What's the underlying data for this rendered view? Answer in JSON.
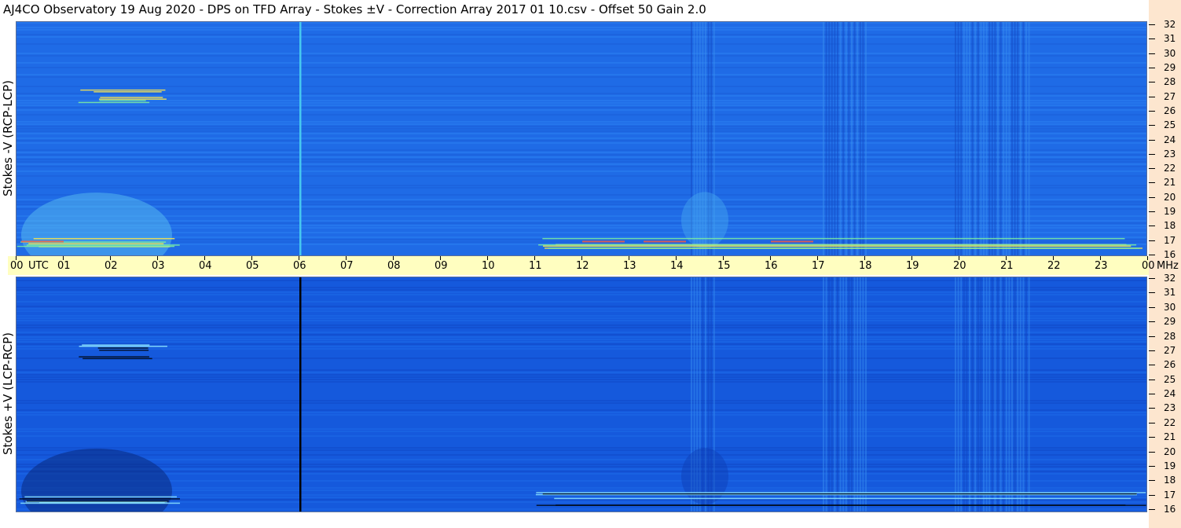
{
  "title": "AJ4CO Observatory  19 Aug 2020  -  DPS on TFD Array  -  Stokes ±V  -  Correction Array 2017 01 10.csv  -  Offset 50  Gain 2.0",
  "chart_data": [
    {
      "type": "heatmap",
      "ylabel": "Stokes -V (RCP-LCP)",
      "x_unit": "UTC",
      "y_unit": "MHz",
      "xlim": [
        0,
        24
      ],
      "ylim": [
        16,
        32
      ],
      "colormap": [
        "#0a2a9a",
        "#1f6be6",
        "#2f8df5",
        "#6ad0f5",
        "#ffe84a",
        "#ff5a3a"
      ],
      "features": [
        {
          "kind": "marker_line",
          "time_utc": 6.0,
          "color": "#46c8f0"
        },
        {
          "kind": "burst_band",
          "time_utc": [
            11.0,
            24.0
          ],
          "freq_mhz": 17.0
        },
        {
          "kind": "burst_band",
          "time_utc": [
            0.0,
            3.5
          ],
          "freq_mhz": 17.0
        },
        {
          "kind": "burst_band",
          "time_utc": [
            1.3,
            3.2
          ],
          "freq_mhz": 27.0
        }
      ]
    },
    {
      "type": "heatmap",
      "ylabel": "Stokes +V (LCP-RCP)",
      "x_unit": "UTC",
      "y_unit": "MHz",
      "xlim": [
        0,
        24
      ],
      "ylim": [
        16,
        32
      ],
      "colormap": [
        "#000814",
        "#0a2a9a",
        "#1f6be6",
        "#2f8df5",
        "#6ad0f5"
      ],
      "features": [
        {
          "kind": "marker_line",
          "time_utc": 6.0,
          "color": "#000000"
        },
        {
          "kind": "burst_band",
          "time_utc": [
            11.0,
            24.0
          ],
          "freq_mhz": 17.0
        },
        {
          "kind": "burst_band",
          "time_utc": [
            0.0,
            3.5
          ],
          "freq_mhz": 17.0
        },
        {
          "kind": "burst_band",
          "time_utc": [
            1.3,
            3.2
          ],
          "freq_mhz": 27.0
        }
      ]
    }
  ],
  "time_axis": {
    "labels": [
      "00",
      "01",
      "02",
      "03",
      "04",
      "05",
      "06",
      "07",
      "08",
      "09",
      "10",
      "11",
      "12",
      "13",
      "14",
      "15",
      "16",
      "17",
      "18",
      "19",
      "20",
      "21",
      "22",
      "23",
      "00"
    ],
    "unit_label": "UTC",
    "freq_unit_label": "MHz"
  },
  "freq_axis": {
    "labels": [
      "32",
      "31",
      "30",
      "29",
      "28",
      "27",
      "26",
      "25",
      "24",
      "23",
      "22",
      "21",
      "20",
      "19",
      "18",
      "17",
      "16"
    ]
  }
}
